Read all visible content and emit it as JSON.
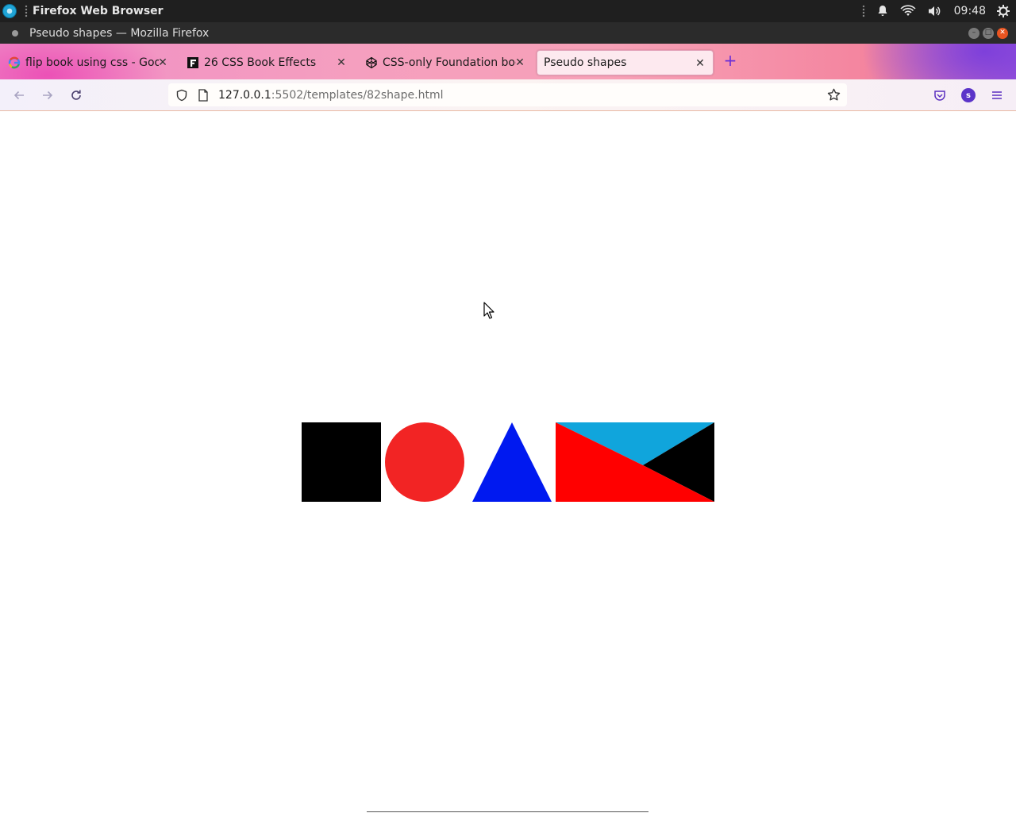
{
  "os_panel": {
    "app_title": "Firefox Web Browser",
    "clock": "09:48"
  },
  "window": {
    "title": "Pseudo shapes — Mozilla Firefox"
  },
  "tabs": [
    {
      "label": "flip book using css - Goog",
      "favicon": "google-icon",
      "active": false
    },
    {
      "label": "26 CSS Book Effects",
      "favicon": "freefrontend-icon",
      "active": false
    },
    {
      "label": "CSS-only Foundation boo",
      "favicon": "codepen-icon",
      "active": false
    },
    {
      "label": "Pseudo shapes",
      "favicon": "",
      "active": true
    }
  ],
  "address_bar": {
    "host": "127.0.0.1",
    "path": ":5502/templates/82shape.html"
  },
  "account_avatar_letter": "S",
  "shapes": [
    {
      "type": "square",
      "color": "#000000"
    },
    {
      "type": "circle",
      "color": "#f22424"
    },
    {
      "type": "triangle",
      "color": "#0019f0"
    },
    {
      "type": "envelope",
      "colors": {
        "top": "#10a5dc",
        "right": "#000000",
        "bottom": "#ff0000"
      }
    }
  ]
}
